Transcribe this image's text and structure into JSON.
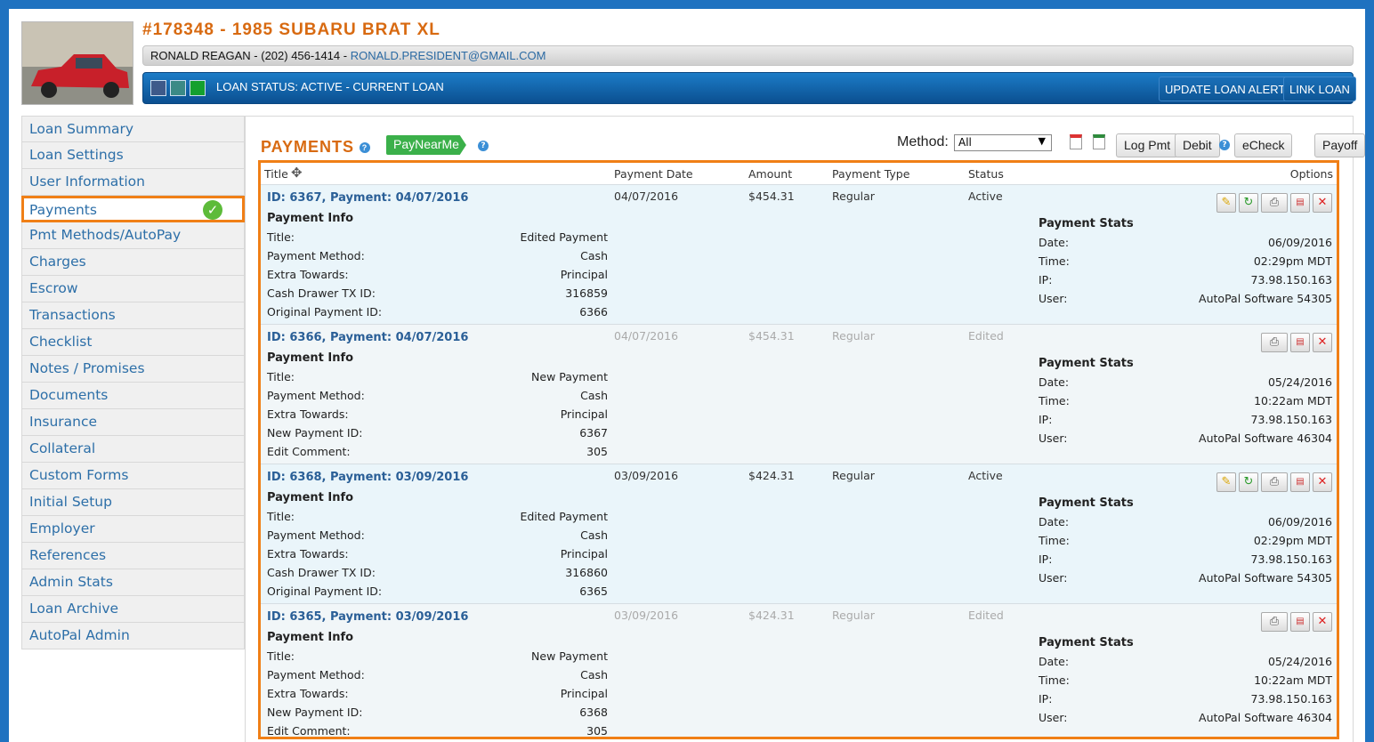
{
  "header": {
    "title": "#178348 - 1985 SUBARU BRAT XL",
    "customer": "RONALD REAGAN - (202) 456-1414 - ",
    "email": "RONALD.PRESIDENT@GMAIL.COM",
    "loan_status": "LOAN STATUS: ACTIVE - CURRENT LOAN",
    "update_alert": "UPDATE LOAN ALERT",
    "link_loan": "LINK LOAN"
  },
  "sidebar": {
    "items": [
      "Loan Summary",
      "Loan Settings",
      "User Information",
      "Payments",
      "Pmt Methods/AutoPay",
      "Charges",
      "Escrow",
      "Transactions",
      "Checklist",
      "Notes / Promises",
      "Documents",
      "Insurance",
      "Collateral",
      "Custom Forms",
      "Initial Setup",
      "Employer",
      "References",
      "Admin Stats",
      "Loan Archive",
      "AutoPal Admin"
    ],
    "active": "Payments"
  },
  "toolbar": {
    "title": "PAYMENTS",
    "paynearme": "PayNearMe",
    "method_label": "Method:",
    "method_value": "All",
    "log_pmt": "Log Pmt",
    "debit": "Debit",
    "echeck": "eCheck",
    "payoff": "Payoff"
  },
  "columns": [
    "Title",
    "Payment Date",
    "Amount",
    "Payment Type",
    "Status",
    "Options"
  ],
  "records": [
    {
      "id": "ID: 6367, Payment: 04/07/2016",
      "date": "04/07/2016",
      "amount": "$454.31",
      "type": "Regular",
      "status": "Active",
      "info_title": "Payment Info",
      "info": [
        [
          "Title:",
          "Edited Payment"
        ],
        [
          "Payment Method:",
          "Cash"
        ],
        [
          "Extra Towards:",
          "Principal"
        ],
        [
          "Cash Drawer TX ID:",
          "316859"
        ],
        [
          "Original Payment ID:",
          "6366"
        ]
      ],
      "stats_title": "Payment Stats",
      "stats": [
        [
          "Date:",
          "06/09/2016"
        ],
        [
          "Time:",
          "02:29pm MDT"
        ],
        [
          "IP:",
          "73.98.150.163"
        ],
        [
          "User:",
          "AutoPal Software 54305"
        ]
      ]
    },
    {
      "id": "ID: 6366, Payment: 04/07/2016",
      "date": "04/07/2016",
      "amount": "$454.31",
      "type": "Regular",
      "status": "Edited",
      "info_title": "Payment Info",
      "info": [
        [
          "Title:",
          "New Payment"
        ],
        [
          "Payment Method:",
          "Cash"
        ],
        [
          "Extra Towards:",
          "Principal"
        ],
        [
          "New Payment ID:",
          "6367"
        ],
        [
          "Edit Comment:",
          "305"
        ]
      ],
      "stats_title": "Payment Stats",
      "stats": [
        [
          "Date:",
          "05/24/2016"
        ],
        [
          "Time:",
          "10:22am MDT"
        ],
        [
          "IP:",
          "73.98.150.163"
        ],
        [
          "User:",
          "AutoPal Software 46304"
        ]
      ]
    },
    {
      "id": "ID: 6368, Payment: 03/09/2016",
      "date": "03/09/2016",
      "amount": "$424.31",
      "type": "Regular",
      "status": "Active",
      "info_title": "Payment Info",
      "info": [
        [
          "Title:",
          "Edited Payment"
        ],
        [
          "Payment Method:",
          "Cash"
        ],
        [
          "Extra Towards:",
          "Principal"
        ],
        [
          "Cash Drawer TX ID:",
          "316860"
        ],
        [
          "Original Payment ID:",
          "6365"
        ]
      ],
      "stats_title": "Payment Stats",
      "stats": [
        [
          "Date:",
          "06/09/2016"
        ],
        [
          "Time:",
          "02:29pm MDT"
        ],
        [
          "IP:",
          "73.98.150.163"
        ],
        [
          "User:",
          "AutoPal Software 54305"
        ]
      ]
    },
    {
      "id": "ID: 6365, Payment: 03/09/2016",
      "date": "03/09/2016",
      "amount": "$424.31",
      "type": "Regular",
      "status": "Edited",
      "info_title": "Payment Info",
      "info": [
        [
          "Title:",
          "New Payment"
        ],
        [
          "Payment Method:",
          "Cash"
        ],
        [
          "Extra Towards:",
          "Principal"
        ],
        [
          "New Payment ID:",
          "6368"
        ],
        [
          "Edit Comment:",
          "305"
        ]
      ],
      "stats_title": "Payment Stats",
      "stats": [
        [
          "Date:",
          "05/24/2016"
        ],
        [
          "Time:",
          "10:22am MDT"
        ],
        [
          "IP:",
          "73.98.150.163"
        ],
        [
          "User:",
          "AutoPal Software 46304"
        ]
      ]
    }
  ],
  "icons": {
    "edit": "pencil-icon",
    "refresh": "refresh-icon",
    "print": "printer-icon",
    "pdf": "pdf-icon",
    "delete": "delete-icon",
    "excel": "excel-icon",
    "help": "help-icon",
    "check": "check-icon"
  },
  "colors": {
    "accent": "#d86a11",
    "highlight": "#f07f16",
    "link": "#2d6fa8",
    "status_bar": "#0b4f90"
  }
}
